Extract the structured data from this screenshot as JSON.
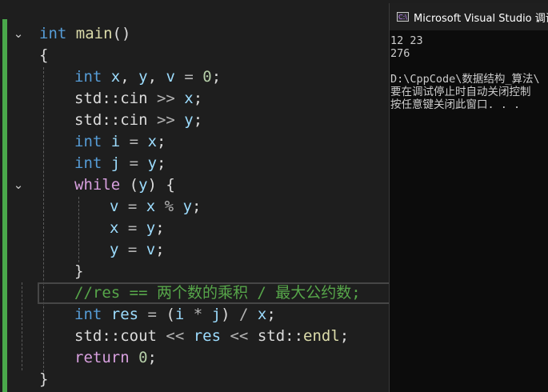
{
  "editor": {
    "lines": [
      [
        [
          "kw",
          "int"
        ],
        [
          "",
          " "
        ],
        [
          "fn",
          "main"
        ],
        [
          "",
          "()"
        ]
      ],
      [
        [
          "",
          "{"
        ]
      ],
      [
        [
          "kw",
          "int"
        ],
        [
          "",
          " "
        ],
        [
          "var",
          "x"
        ],
        [
          "",
          ", "
        ],
        [
          "var",
          "y"
        ],
        [
          "",
          ", "
        ],
        [
          "var",
          "v"
        ],
        [
          "op",
          " = "
        ],
        [
          "num",
          "0"
        ],
        [
          "",
          ";"
        ]
      ],
      [
        [
          "",
          "std::cin "
        ],
        [
          "op",
          ">>"
        ],
        [
          "",
          ""
        ],
        [
          "var",
          " x"
        ],
        [
          "",
          ";"
        ]
      ],
      [
        [
          "",
          "std::cin "
        ],
        [
          "op",
          ">>"
        ],
        [
          "var",
          " y"
        ],
        [
          "",
          ";"
        ]
      ],
      [
        [
          "kw",
          "int"
        ],
        [
          "",
          " "
        ],
        [
          "var",
          "i"
        ],
        [
          "op",
          " = "
        ],
        [
          "var",
          "x"
        ],
        [
          "",
          ";"
        ]
      ],
      [
        [
          "kw",
          "int"
        ],
        [
          "",
          " "
        ],
        [
          "var",
          "j"
        ],
        [
          "op",
          " = "
        ],
        [
          "var",
          "y"
        ],
        [
          "",
          ";"
        ]
      ],
      [
        [
          "ctl",
          "while"
        ],
        [
          "",
          ""
        ],
        [
          "",
          ""
        ],
        [
          "var",
          ""
        ],
        [
          "",
          ""
        ],
        [
          "",
          ""
        ],
        [
          "",
          ""
        ],
        [
          "",
          ""
        ],
        [
          "",
          ""
        ],
        [
          "",
          ""
        ],
        [
          "",
          ""
        ],
        [
          "",
          " ("
        ],
        [
          "var",
          "y"
        ],
        [
          "",
          ") {"
        ]
      ],
      [
        [
          "var",
          "v"
        ],
        [
          "op",
          " = "
        ],
        [
          "var",
          "x"
        ],
        [
          "op",
          " % "
        ],
        [
          "var",
          "y"
        ],
        [
          "",
          ";"
        ]
      ],
      [
        [
          "var",
          "x"
        ],
        [
          "op",
          " = "
        ],
        [
          "var",
          "y"
        ],
        [
          "",
          ";"
        ]
      ],
      [
        [
          "var",
          "y"
        ],
        [
          "op",
          " = "
        ],
        [
          "var",
          "v"
        ],
        [
          "",
          ";"
        ]
      ],
      [
        [
          "",
          "}"
        ]
      ],
      [
        [
          "cmt",
          "//res == 两个数的乘积 / 最大公约数;"
        ]
      ],
      [
        [
          "kw",
          "int"
        ],
        [
          "",
          " "
        ],
        [
          "var",
          "res"
        ],
        [
          "op",
          " = "
        ],
        [
          "",
          "("
        ],
        [
          "var",
          "i"
        ],
        [
          "op",
          " * "
        ],
        [
          "var",
          "j"
        ],
        [
          "",
          ")"
        ],
        [
          "op",
          " / "
        ],
        [
          "var",
          "x"
        ],
        [
          "",
          ";"
        ]
      ],
      [
        [
          "",
          "std::cout "
        ],
        [
          "op",
          "<<"
        ],
        [
          "var",
          " res "
        ],
        [
          "op",
          "<<"
        ],
        [
          "",
          " std::"
        ],
        [
          "fn",
          "endl"
        ],
        [
          "",
          ";"
        ]
      ],
      [
        [
          "ctl",
          "return"
        ],
        [
          "",
          " "
        ],
        [
          "num",
          "0"
        ],
        [
          "",
          ";"
        ]
      ],
      [
        [
          "",
          "}"
        ]
      ]
    ]
  },
  "console": {
    "title": "Microsoft Visual Studio 调试控制台",
    "icon_label": "C:\\",
    "lines": [
      "12 23",
      "276",
      "",
      "D:\\CppCode\\数据结构_算法\\",
      "要在调试停止时自动关闭控制",
      "按任意键关闭此窗口. . ."
    ]
  },
  "colors": {
    "added_bar": "#4aa84b",
    "keyword": "#569cd6",
    "control": "#d8a0df",
    "comment": "#57a64a"
  }
}
